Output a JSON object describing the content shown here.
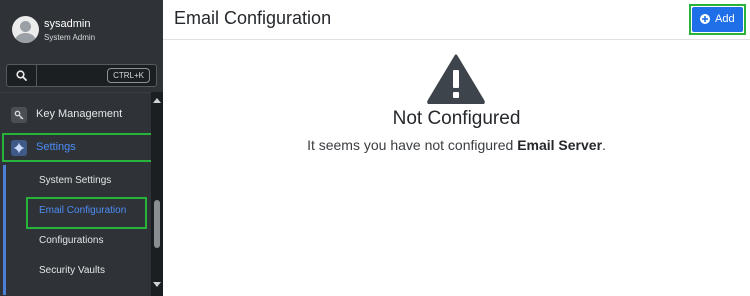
{
  "user": {
    "name": "sysadmin",
    "role": "System Admin"
  },
  "search": {
    "shortcut": "CTRL+K"
  },
  "nav": [
    {
      "label": "Key Management",
      "icon": "key-icon",
      "active": false
    },
    {
      "label": "Settings",
      "icon": "gear-icon",
      "active": true
    }
  ],
  "settings_submenu": [
    {
      "label": "System Settings",
      "active": false
    },
    {
      "label": "Email Configuration",
      "active": true
    },
    {
      "label": "Configurations",
      "active": false
    },
    {
      "label": "Security Vaults",
      "active": false
    }
  ],
  "page": {
    "title": "Email Configuration",
    "add_label": "Add"
  },
  "empty_state": {
    "icon": "warning-icon",
    "title": "Not Configured",
    "message_prefix": "It seems you have not configured ",
    "message_bold": "Email Server",
    "message_suffix": "."
  },
  "colors": {
    "sidebar_bg": "#2f3338",
    "accent": "#1f6fe8",
    "highlight": "#28b33a",
    "active_text": "#4d8cf5"
  }
}
